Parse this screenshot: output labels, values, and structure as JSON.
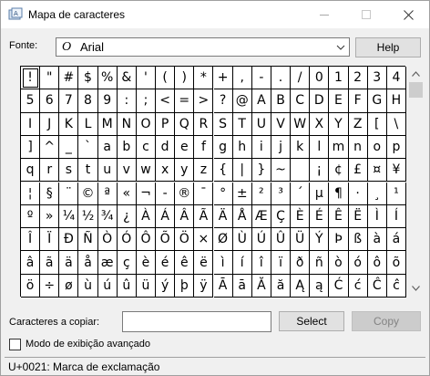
{
  "window": {
    "title": "Mapa de caracteres"
  },
  "font": {
    "label": "Fonte:",
    "selected": "Arial",
    "glyph": "O"
  },
  "buttons": {
    "help": "Help",
    "select": "Select",
    "copy": "Copy"
  },
  "characters": [
    "!",
    "\"",
    "#",
    "$",
    "%",
    "&",
    "'",
    "(",
    ")",
    "*",
    "+",
    ",",
    "-",
    ".",
    "/",
    "0",
    "1",
    "2",
    "3",
    "4",
    "5",
    "6",
    "7",
    "8",
    "9",
    ":",
    ";",
    "<",
    "=",
    ">",
    "?",
    "@",
    "A",
    "B",
    "C",
    "D",
    "E",
    "F",
    "G",
    "H",
    "I",
    "J",
    "K",
    "L",
    "M",
    "N",
    "O",
    "P",
    "Q",
    "R",
    "S",
    "T",
    "U",
    "V",
    "W",
    "X",
    "Y",
    "Z",
    "[",
    "\\",
    "]",
    "^",
    "_",
    "`",
    "a",
    "b",
    "c",
    "d",
    "e",
    "f",
    "g",
    "h",
    "i",
    "j",
    "k",
    "l",
    "m",
    "n",
    "o",
    "p",
    "q",
    "r",
    "s",
    "t",
    "u",
    "v",
    "w",
    "x",
    "y",
    "z",
    "{",
    "|",
    "}",
    "~",
    "",
    "¡",
    "¢",
    "£",
    "¤",
    "¥",
    "¦",
    "§",
    "¨",
    "©",
    "ª",
    "«",
    "¬",
    "-",
    "®",
    "¯",
    "°",
    "±",
    "²",
    "³",
    "´",
    "µ",
    "¶",
    "·",
    "¸",
    "¹",
    "º",
    "»",
    "¼",
    "½",
    "¾",
    "¿",
    "À",
    "Á",
    "Â",
    "Ã",
    "Ä",
    "Å",
    "Æ",
    "Ç",
    "È",
    "É",
    "Ê",
    "Ë",
    "Ì",
    "Í",
    "Î",
    "Ï",
    "Ð",
    "Ñ",
    "Ò",
    "Ó",
    "Ô",
    "Õ",
    "Ö",
    "×",
    "Ø",
    "Ù",
    "Ú",
    "Û",
    "Ü",
    "Ý",
    "Þ",
    "ß",
    "à",
    "á",
    "â",
    "ã",
    "ä",
    "å",
    "æ",
    "ç",
    "è",
    "é",
    "ê",
    "ë",
    "ì",
    "í",
    "î",
    "ï",
    "ð",
    "ñ",
    "ò",
    "ó",
    "ô",
    "õ",
    "ö",
    "÷",
    "ø",
    "ù",
    "ú",
    "û",
    "ü",
    "ý",
    "þ",
    "ÿ",
    "Ā",
    "ā",
    "Ă",
    "ă",
    "Ą",
    "ą",
    "Ć",
    "ć",
    "Ĉ",
    "ĉ"
  ],
  "selected_index": 0,
  "copy": {
    "label": "Caracteres a copiar:",
    "value": ""
  },
  "advanced": {
    "label": "Modo de exibição avançado",
    "checked": false
  },
  "status": {
    "text": "U+0021: Marca de exclamação"
  },
  "icons": {
    "app": "charmap-icon",
    "minimize": "minimize-icon",
    "maximize": "maximize-icon",
    "close": "close-icon",
    "dropdown": "chevron-down-icon",
    "scroll_up": "chevron-up-icon",
    "scroll_down": "chevron-down-icon"
  }
}
